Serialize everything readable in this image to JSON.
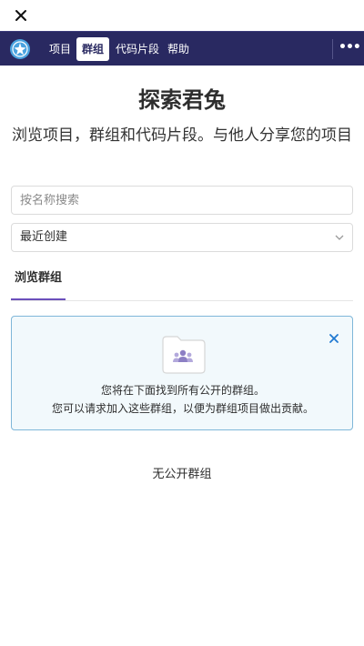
{
  "topbar": {
    "close_icon": "close-icon"
  },
  "navbar": {
    "logo_icon": "gitee-logo-icon",
    "items": [
      {
        "label": "项目",
        "active": false
      },
      {
        "label": "群组",
        "active": true
      },
      {
        "label": "代码片段",
        "active": false
      },
      {
        "label": "帮助",
        "active": false
      }
    ],
    "more_label": "•••",
    "colors": {
      "background": "#292961",
      "active_bg": "#ffffff"
    }
  },
  "header": {
    "title": "探索君兔",
    "subtitle": "浏览项目，群组和代码片段。与他人分享您的项目"
  },
  "filters": {
    "search_placeholder": "按名称搜索",
    "sort_value": "最近创建"
  },
  "tabs": [
    {
      "label": "浏览群组",
      "active": true
    }
  ],
  "info_box": {
    "line1": "您将在下面找到所有公开的群组。",
    "line2": "您可以请求加入这些群组，以便为群组项目做出贡献。",
    "icon": "group-folder-icon",
    "dismiss_icon": "close-icon",
    "colors": {
      "background": "#f2f9fc",
      "border": "#7fb7d9"
    }
  },
  "empty_state": {
    "text": "无公开群组"
  },
  "accent_color": "#6b4fbb"
}
